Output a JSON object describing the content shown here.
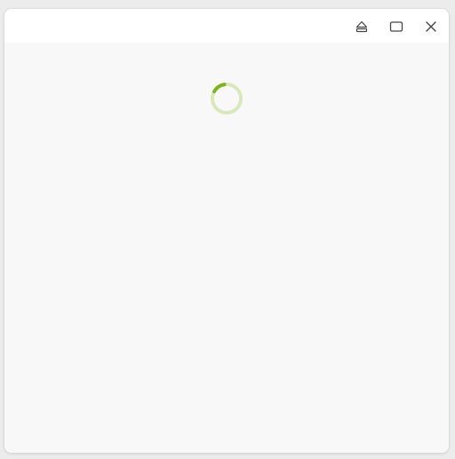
{
  "window": {
    "title": "",
    "controls": {
      "eject_icon": "eject-icon",
      "maximize_icon": "maximize-icon",
      "close_icon": "close-icon"
    }
  },
  "content": {
    "state": "loading",
    "spinner_icon": "loading-spinner-icon"
  },
  "colors": {
    "spinner_track": "#d9e8b8",
    "spinner_arc": "#7cb518",
    "titlebar": "#ffffff",
    "content_bg": "#f8f8f8",
    "icon": "#444444"
  }
}
